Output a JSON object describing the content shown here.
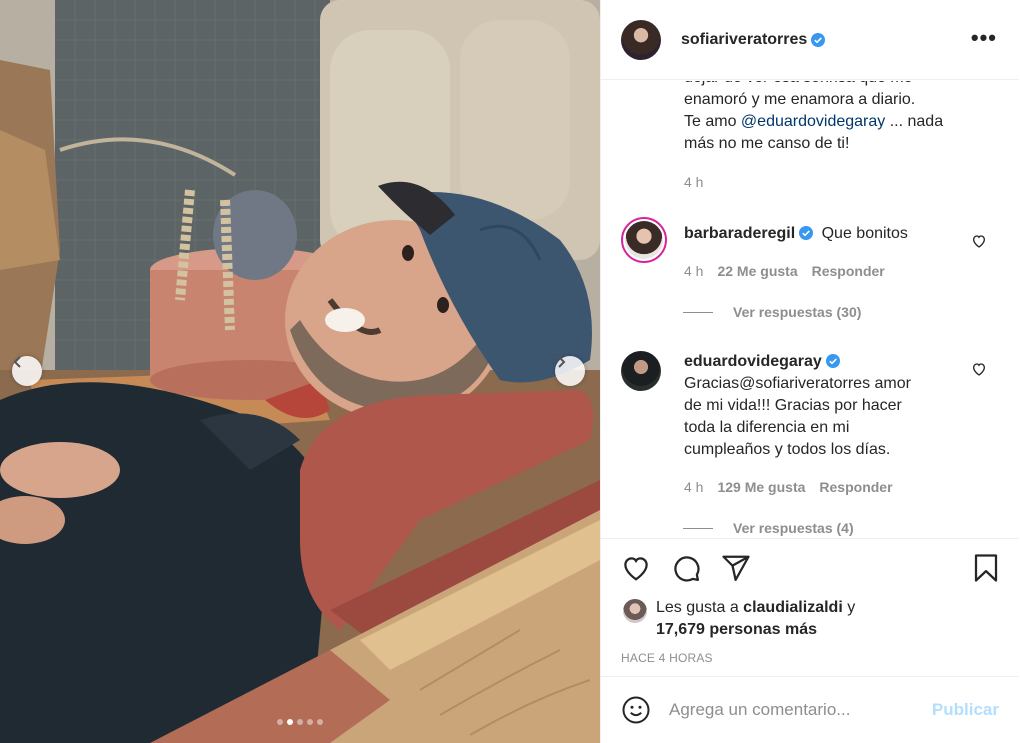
{
  "post": {
    "username": "sofiariveratorres",
    "more_label": "•••",
    "carousel": {
      "slide_count": 5,
      "active_index": 1
    }
  },
  "caption": {
    "line1": "dejar de ver esa sonrisa que me",
    "line2": "enamoró y me enamora a diario.",
    "line3_prefix": "Te amo ",
    "mention": "@eduardovidegaray",
    "line3_suffix": " ... nada",
    "line4": "más no me canso de ti!",
    "time": "4 h"
  },
  "comments": [
    {
      "username": "barbaraderegil",
      "text": "Que bonitos",
      "time": "4 h",
      "likes": "22 Me gusta",
      "reply_label": "Responder",
      "view_replies": "Ver respuestas (30)"
    },
    {
      "username": "eduardovidegaray",
      "text_lines": [
        "Gracias@sofiariveratorres amor",
        "de mi vida!!! Gracias por hacer",
        "toda la diferencia en mi",
        "cumpleaños y todos los días."
      ],
      "time": "4 h",
      "likes": "129 Me gusta",
      "reply_label": "Responder",
      "view_replies": "Ver respuestas (4)"
    }
  ],
  "likes": {
    "prefix": "Les gusta a ",
    "user": "claudializaldi",
    "middle": " y",
    "count": "17,679 personas más"
  },
  "time_ago": "HACE 4 HORAS",
  "add_comment": {
    "placeholder": "Agrega un comentario...",
    "publish_label": "Publicar"
  },
  "colors": {
    "verified": "#3897f0",
    "link": "#00376b",
    "publish_disabled": "#b2dffc",
    "muted": "#8e8e8e"
  }
}
